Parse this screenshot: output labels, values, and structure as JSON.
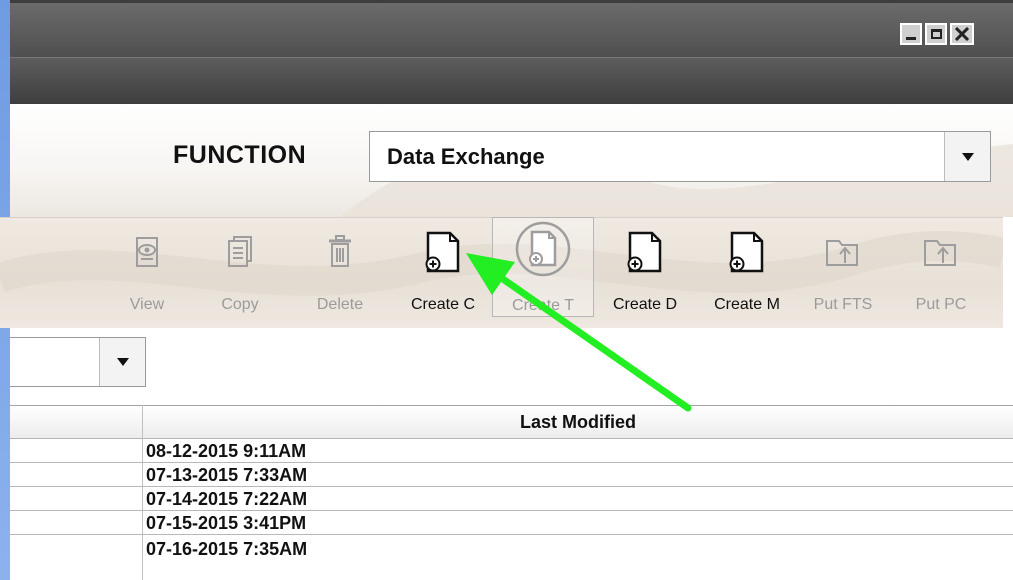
{
  "window": {
    "controls": {
      "minimize_icon": "minimize-icon",
      "maximize_icon": "maximize-icon",
      "close_icon": "close-icon"
    }
  },
  "function": {
    "label": "FUNCTION",
    "selected": "Data Exchange"
  },
  "toolbar": {
    "items": [
      {
        "label": "View",
        "icon": "view-icon",
        "enabled": false
      },
      {
        "label": "Copy",
        "icon": "copy-icon",
        "enabled": false
      },
      {
        "label": "Delete",
        "icon": "trash-icon",
        "enabled": false
      },
      {
        "label": "Create C",
        "icon": "new-document-icon",
        "enabled": true
      },
      {
        "label": "Create T",
        "icon": "new-document-icon",
        "enabled": false
      },
      {
        "label": "Create D",
        "icon": "new-document-icon",
        "enabled": true
      },
      {
        "label": "Create M",
        "icon": "new-document-icon",
        "enabled": true
      },
      {
        "label": "Put FTS",
        "icon": "upload-icon",
        "enabled": false
      },
      {
        "label": "Put PC",
        "icon": "upload-icon",
        "enabled": false
      }
    ]
  },
  "filter": {
    "selected": ""
  },
  "table": {
    "columns": [
      "Last Modified"
    ],
    "rows": [
      "08-12-2015 9:11AM",
      "07-13-2015 7:33AM",
      "07-14-2015 7:22AM",
      "07-15-2015 3:41PM",
      "07-16-2015 7:35AM"
    ]
  },
  "annotation": {
    "arrow_color": "#22ee22"
  }
}
